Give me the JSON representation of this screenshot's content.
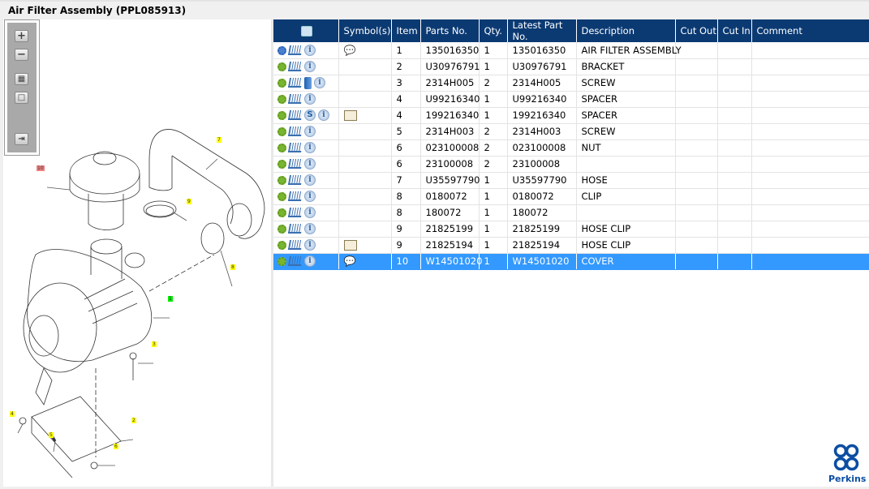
{
  "title": "Air Filter Assembly (PPL085913)",
  "toolbar": {
    "buttons": [
      {
        "name": "zoom-in",
        "glyph": "+"
      },
      {
        "name": "zoom-out",
        "glyph": "−"
      },
      {
        "name": "fit-all",
        "glyph": "▦"
      },
      {
        "name": "actual-size",
        "glyph": "□"
      },
      {
        "name": "export",
        "glyph": "⇥"
      }
    ]
  },
  "diagram": {
    "callouts": [
      {
        "label": "10",
        "color": "#f08080"
      },
      {
        "label": "7",
        "color": "#ffff00"
      },
      {
        "label": "9",
        "color": "#ffff00"
      },
      {
        "label": "8",
        "color": "#ffff00"
      },
      {
        "label": "1",
        "color": "#00ee00"
      },
      {
        "label": "3",
        "color": "#ffff00"
      },
      {
        "label": "4",
        "color": "#ffff00"
      },
      {
        "label": "2",
        "color": "#ffff00"
      },
      {
        "label": "5",
        "color": "#ffff00"
      },
      {
        "label": "6",
        "color": "#ffff00"
      }
    ]
  },
  "table": {
    "columns": [
      "",
      "Symbol(s)",
      "Item",
      "Parts No.",
      "Qty.",
      "Latest Part No.",
      "Description",
      "Cut Out",
      "Cut In",
      "Comment"
    ],
    "rows": [
      {
        "icons": [
          "gears",
          "cart",
          "info"
        ],
        "symbol": "bubble",
        "item": "1",
        "part": "135016350",
        "qty": "1",
        "latest": "135016350",
        "desc": "AIR FILTER ASSEMBLY"
      },
      {
        "icons": [
          "gear",
          "cart",
          "info"
        ],
        "symbol": "",
        "item": "2",
        "part": "U30976791",
        "qty": "1",
        "latest": "U30976791",
        "desc": "BRACKET"
      },
      {
        "icons": [
          "gear",
          "cart",
          "book",
          "info"
        ],
        "symbol": "",
        "item": "3",
        "part": "2314H005",
        "qty": "2",
        "latest": "2314H005",
        "desc": "SCREW"
      },
      {
        "icons": [
          "gear",
          "cart",
          "info"
        ],
        "symbol": "",
        "item": "4",
        "part": "U99216340",
        "qty": "1",
        "latest": "U99216340",
        "desc": "SPACER"
      },
      {
        "icons": [
          "gear",
          "cart",
          "s",
          "info"
        ],
        "symbol": "magnifier",
        "item": "4",
        "part": "199216340",
        "qty": "1",
        "latest": "199216340",
        "desc": "SPACER"
      },
      {
        "icons": [
          "gear",
          "cart",
          "info"
        ],
        "symbol": "",
        "item": "5",
        "part": "2314H003",
        "qty": "2",
        "latest": "2314H003",
        "desc": "SCREW"
      },
      {
        "icons": [
          "gear",
          "cart",
          "info"
        ],
        "symbol": "",
        "item": "6",
        "part": "023100008",
        "qty": "2",
        "latest": "023100008",
        "desc": "NUT"
      },
      {
        "icons": [
          "gear",
          "cart",
          "info"
        ],
        "symbol": "",
        "item": "6",
        "part": "23100008",
        "qty": "2",
        "latest": "23100008",
        "desc": ""
      },
      {
        "icons": [
          "gear",
          "cart",
          "info"
        ],
        "symbol": "",
        "item": "7",
        "part": "U35597790",
        "qty": "1",
        "latest": "U35597790",
        "desc": "HOSE"
      },
      {
        "icons": [
          "gear",
          "cart",
          "info"
        ],
        "symbol": "",
        "item": "8",
        "part": "0180072",
        "qty": "1",
        "latest": "0180072",
        "desc": "CLIP"
      },
      {
        "icons": [
          "gear",
          "cart",
          "info"
        ],
        "symbol": "",
        "item": "8",
        "part": "180072",
        "qty": "1",
        "latest": "180072",
        "desc": ""
      },
      {
        "icons": [
          "gear",
          "cart",
          "info"
        ],
        "symbol": "",
        "item": "9",
        "part": "21825199",
        "qty": "1",
        "latest": "21825199",
        "desc": "HOSE CLIP"
      },
      {
        "icons": [
          "gear",
          "cart",
          "info"
        ],
        "symbol": "magnifier",
        "item": "9",
        "part": "21825194",
        "qty": "1",
        "latest": "21825194",
        "desc": "HOSE CLIP"
      },
      {
        "icons": [
          "gear",
          "cart",
          "info"
        ],
        "symbol": "bubble",
        "item": "10",
        "part": "W14501020",
        "qty": "1",
        "latest": "W14501020",
        "desc": "COVER",
        "selected": true
      }
    ]
  },
  "logo": {
    "text": "Perkins"
  },
  "colors": {
    "header": "#0b3a73",
    "selection": "#3399ff",
    "brand": "#0b4ea2"
  }
}
